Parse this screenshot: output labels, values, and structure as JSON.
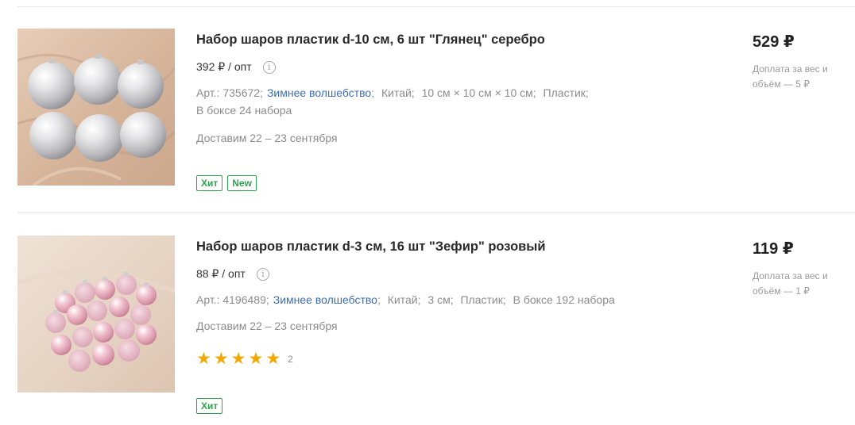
{
  "products": [
    {
      "title": "Набор шаров пластик d-10 см, 6 шт \"Глянец\" серебро",
      "unit_price": "392 ₽ / опт",
      "art": "Арт.: 735672;",
      "category": "Зимнее волшебство",
      "country": "Китай;",
      "size": "10 см × 10 см × 10 см;",
      "material": "Пластик;",
      "box": "В боксе 24 набора",
      "delivery": "Доставим 22 – 23 сентября",
      "badges": [
        "Хит",
        "New"
      ],
      "price": "529 ₽",
      "surcharge": "Доплата за вес и объём — 5 ₽",
      "image_icon": "silver-ornaments-photo"
    },
    {
      "title": "Набор шаров пластик d-3 см, 16 шт \"Зефир\" розовый",
      "unit_price": "88 ₽ / опт",
      "art": "Арт.: 4196489;",
      "category": "Зимнее волшебство",
      "country": "Китай;",
      "size": "3 см;",
      "material": "Пластик;",
      "box": "В боксе 192 набора",
      "delivery": "Доставим 22 – 23 сентября",
      "rating": 5,
      "rating_count": "2",
      "badges": [
        "Хит"
      ],
      "price": "119 ₽",
      "surcharge": "Доплата за вес и объём — 1 ₽",
      "image_icon": "pink-ornaments-photo"
    }
  ],
  "colors": {
    "link": "#3d6fb4",
    "badge": "#2da44e",
    "star": "#f2a800",
    "muted": "#8c8c8c"
  },
  "icons": {
    "info": "info-icon",
    "star": "star-icon"
  }
}
